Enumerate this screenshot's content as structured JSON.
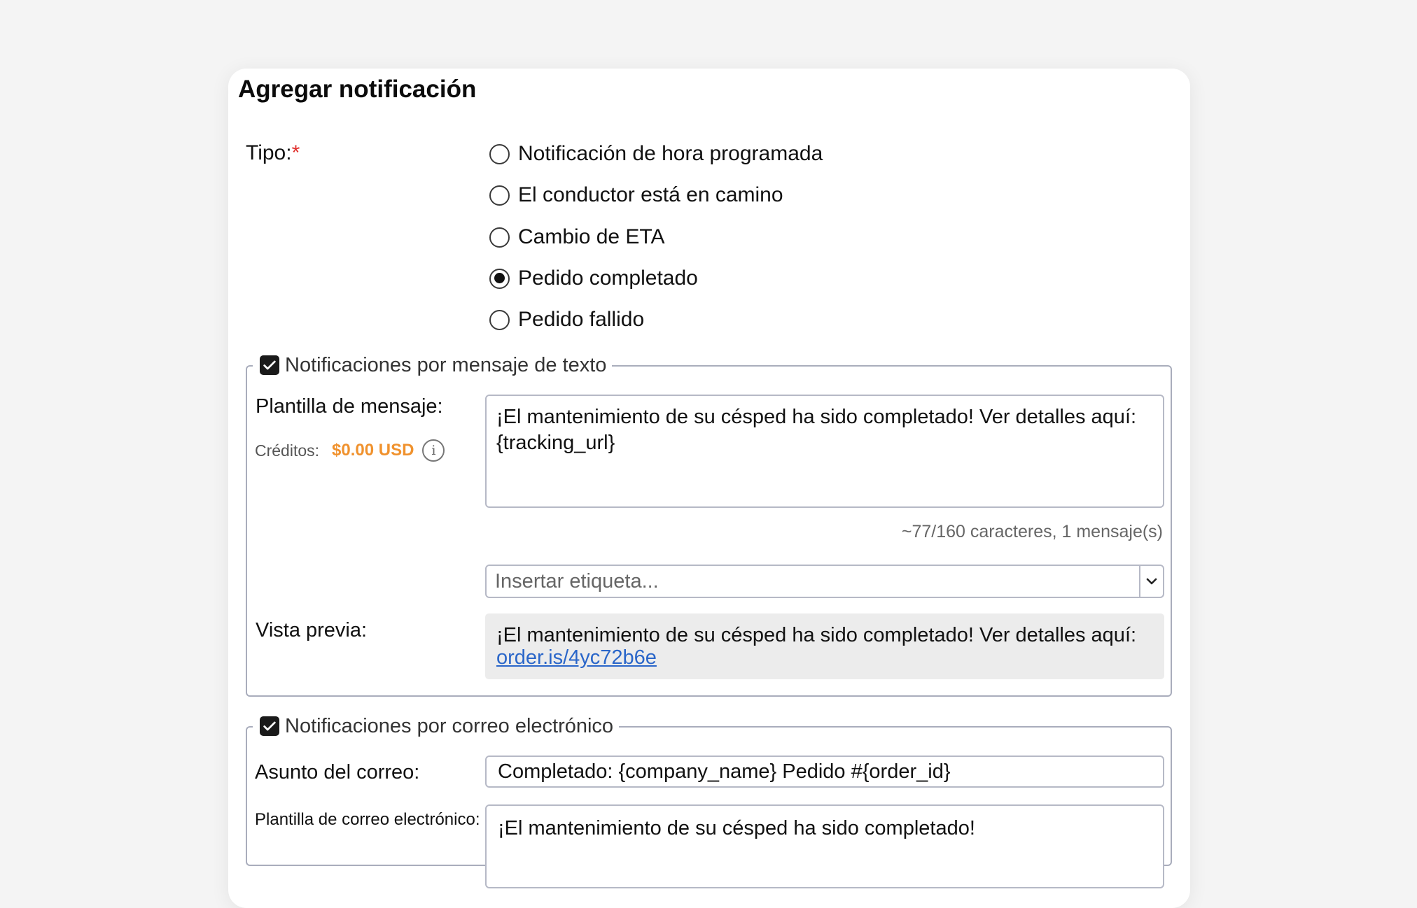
{
  "form": {
    "title": "Agregar notificación",
    "type_label": "Tipo:",
    "required_mark": "*",
    "type_options": [
      {
        "label": "Notificación de hora programada",
        "selected": false
      },
      {
        "label": "El conductor está en camino",
        "selected": false
      },
      {
        "label": "Cambio de ETA",
        "selected": false
      },
      {
        "label": "Pedido completado",
        "selected": true
      },
      {
        "label": "Pedido fallido",
        "selected": false
      }
    ]
  },
  "sms": {
    "legend": "Notificaciones por mensaje de texto",
    "enabled": true,
    "template_label": "Plantilla de mensaje:",
    "credits_label": "Créditos:",
    "credits_value": "$0.00 USD",
    "info_glyph": "i",
    "template_value": "¡El mantenimiento de su césped ha sido completado! Ver detalles aquí: {tracking_url}",
    "char_count": "~77/160 caracteres, 1 mensaje(s)",
    "tag_placeholder": "Insertar etiqueta...",
    "preview_label": "Vista previa:",
    "preview_text": "¡El mantenimiento de su césped ha sido completado!  Ver detalles aquí:",
    "preview_link": "order.is/4yc72b6e"
  },
  "email": {
    "legend": "Notificaciones por correo electrónico",
    "enabled": true,
    "subject_label": "Asunto del correo:",
    "subject_value": "Completado: {company_name} Pedido #{order_id}",
    "template_label": "Plantilla de correo electrónico:",
    "template_value": "¡El mantenimiento de su césped ha sido completado!"
  },
  "icons": {
    "checkbox": "checkmark-icon",
    "dropdown": "chevron-down-icon",
    "info": "info-icon"
  },
  "colors": {
    "required": "#e0302d",
    "credits": "#f0922e",
    "link": "#2a66c9",
    "preview_bg": "#ececec"
  }
}
